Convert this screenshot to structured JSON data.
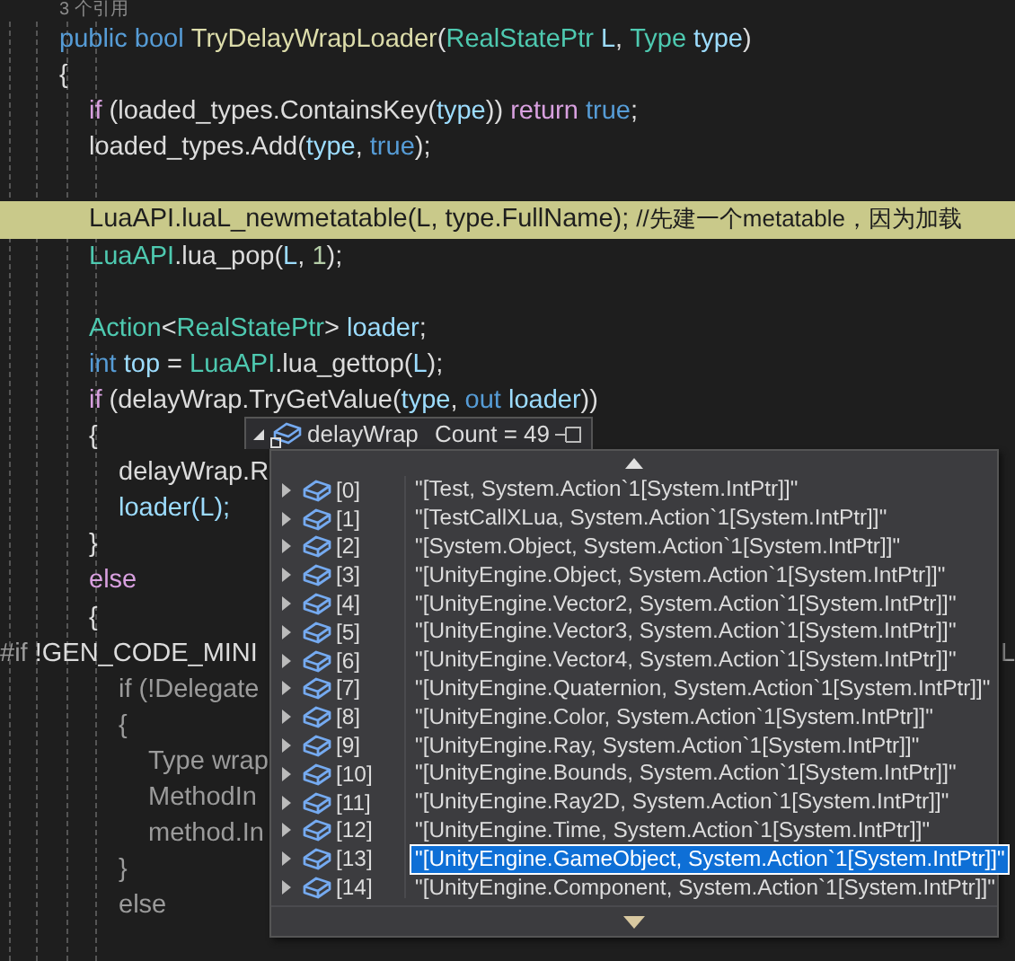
{
  "editor": {
    "codelens": "3 个引用",
    "lines": [
      {
        "tokens": [
          {
            "text": "public ",
            "kind": "kw"
          },
          {
            "text": "bool ",
            "kind": "kw"
          },
          {
            "text": "TryDelayWrapLoader",
            "kind": "method"
          },
          {
            "text": "(",
            "kind": "plain"
          },
          {
            "text": "RealStatePtr",
            "kind": "type"
          },
          {
            "text": " L",
            "kind": "var"
          },
          {
            "text": ", ",
            "kind": "plain"
          },
          {
            "text": "Type",
            "kind": "type"
          },
          {
            "text": " type",
            "kind": "var"
          },
          {
            "text": ")",
            "kind": "plain"
          }
        ]
      },
      {
        "tokens": [
          {
            "text": "{",
            "kind": "plain"
          }
        ],
        "children": [
          {
            "tokens": [
              {
                "text": "if",
                "kind": "ctrl"
              },
              {
                "text": " (loaded_types.ContainsKey(",
                "kind": "plain"
              },
              {
                "text": "type",
                "kind": "var"
              },
              {
                "text": ")) ",
                "kind": "plain"
              },
              {
                "text": "return",
                "kind": "ctrl"
              },
              {
                "text": " true",
                "kind": "kw"
              },
              {
                "text": ";",
                "kind": "plain"
              }
            ]
          },
          {
            "tokens": [
              {
                "text": "loaded_types.Add(",
                "kind": "plain"
              },
              {
                "text": "type",
                "kind": "var"
              },
              {
                "text": ", ",
                "kind": "plain"
              },
              {
                "text": "true",
                "kind": "kw"
              },
              {
                "text": ");",
                "kind": "plain"
              }
            ]
          },
          {
            "gap_before": true,
            "highlighted": true,
            "tokens": [
              {
                "text": "LuaAPI.luaL_newmetatable(L, type.FullName); ",
                "kind": "plain"
              },
              {
                "text": "//先建一个metatable，因为加载",
                "kind": "comment"
              }
            ]
          },
          {
            "tokens": [
              {
                "text": "LuaAPI",
                "kind": "type"
              },
              {
                "text": ".lua_pop(",
                "kind": "plain"
              },
              {
                "text": "L",
                "kind": "var"
              },
              {
                "text": ", ",
                "kind": "plain"
              },
              {
                "text": "1",
                "kind": "num"
              },
              {
                "text": ");",
                "kind": "plain"
              }
            ]
          },
          {
            "gap_before": true,
            "tokens": [
              {
                "text": "Action",
                "kind": "type"
              },
              {
                "text": "<",
                "kind": "plain"
              },
              {
                "text": "RealStatePtr",
                "kind": "type"
              },
              {
                "text": "> ",
                "kind": "plain"
              },
              {
                "text": "loader",
                "kind": "var"
              },
              {
                "text": ";",
                "kind": "plain"
              }
            ]
          },
          {
            "tokens": [
              {
                "text": "int",
                "kind": "kw"
              },
              {
                "text": " top",
                "kind": "var"
              },
              {
                "text": " = ",
                "kind": "plain"
              },
              {
                "text": "LuaAPI",
                "kind": "type"
              },
              {
                "text": ".lua_gettop(",
                "kind": "plain"
              },
              {
                "text": "L",
                "kind": "var"
              },
              {
                "text": ");",
                "kind": "plain"
              }
            ]
          },
          {
            "tokens": [
              {
                "text": "if",
                "kind": "ctrl"
              },
              {
                "text": " (delayWrap.TryGetValue(",
                "kind": "plain"
              },
              {
                "text": "type",
                "kind": "var"
              },
              {
                "text": ", ",
                "kind": "plain"
              },
              {
                "text": "out",
                "kind": "kw"
              },
              {
                "text": " loader",
                "kind": "var"
              },
              {
                "text": "))",
                "kind": "plain"
              }
            ]
          },
          {
            "tokens": [
              {
                "text": "{",
                "kind": "plain"
              }
            ],
            "children": [
              {
                "tokens": [
                  {
                    "text": "delayWrap.R",
                    "kind": "plain"
                  }
                ]
              },
              {
                "tokens": [
                  {
                    "text": "loader(L);",
                    "kind": "var"
                  }
                ]
              }
            ]
          },
          {
            "tokens": [
              {
                "text": "}",
                "kind": "plain"
              }
            ]
          },
          {
            "tokens": [
              {
                "text": "else",
                "kind": "ctrl"
              }
            ]
          },
          {
            "tokens": [
              {
                "text": "{",
                "kind": "plain"
              }
            ],
            "children": [
              {
                "kind": "directive",
                "tokens": [
                  {
                    "text": "#if",
                    "kind": "pre"
                  },
                  {
                    "text": " !GEN_CODE_MINI",
                    "kind": "plain"
                  }
                ],
                "right": "L"
              },
              {
                "tokens": [
                  {
                    "text": "if (!Delegate",
                    "kind": "dim"
                  }
                ]
              },
              {
                "tokens": [
                  {
                    "text": "{",
                    "kind": "dim"
                  }
                ],
                "children": [
                  {
                    "tokens": [
                      {
                        "text": "Type wrap",
                        "kind": "dim"
                      }
                    ]
                  },
                  {
                    "tokens": [
                      {
                        "text": "MethodIn",
                        "kind": "dim"
                      }
                    ]
                  },
                  {
                    "tokens": [
                      {
                        "text": "method.In",
                        "kind": "dim"
                      }
                    ]
                  }
                ]
              },
              {
                "tokens": [
                  {
                    "text": "}",
                    "kind": "dim"
                  }
                ]
              },
              {
                "tokens": [
                  {
                    "text": "else",
                    "kind": "dim"
                  }
                ]
              }
            ]
          }
        ]
      }
    ]
  },
  "datatip": {
    "name": "delayWrap",
    "value": "Count = 49",
    "rows": [
      {
        "index": "[0]",
        "value": "\"[Test, System.Action`1[System.IntPtr]]\"",
        "selected": false
      },
      {
        "index": "[1]",
        "value": "\"[TestCallXLua, System.Action`1[System.IntPtr]]\"",
        "selected": false
      },
      {
        "index": "[2]",
        "value": "\"[System.Object, System.Action`1[System.IntPtr]]\"",
        "selected": false
      },
      {
        "index": "[3]",
        "value": "\"[UnityEngine.Object, System.Action`1[System.IntPtr]]\"",
        "selected": false
      },
      {
        "index": "[4]",
        "value": "\"[UnityEngine.Vector2, System.Action`1[System.IntPtr]]\"",
        "selected": false
      },
      {
        "index": "[5]",
        "value": "\"[UnityEngine.Vector3, System.Action`1[System.IntPtr]]\"",
        "selected": false
      },
      {
        "index": "[6]",
        "value": "\"[UnityEngine.Vector4, System.Action`1[System.IntPtr]]\"",
        "selected": false
      },
      {
        "index": "[7]",
        "value": "\"[UnityEngine.Quaternion, System.Action`1[System.IntPtr]]\"",
        "selected": false
      },
      {
        "index": "[8]",
        "value": "\"[UnityEngine.Color, System.Action`1[System.IntPtr]]\"",
        "selected": false
      },
      {
        "index": "[9]",
        "value": "\"[UnityEngine.Ray, System.Action`1[System.IntPtr]]\"",
        "selected": false
      },
      {
        "index": "[10]",
        "value": "\"[UnityEngine.Bounds, System.Action`1[System.IntPtr]]\"",
        "selected": false
      },
      {
        "index": "[11]",
        "value": "\"[UnityEngine.Ray2D, System.Action`1[System.IntPtr]]\"",
        "selected": false
      },
      {
        "index": "[12]",
        "value": "\"[UnityEngine.Time, System.Action`1[System.IntPtr]]\"",
        "selected": false
      },
      {
        "index": "[13]",
        "value": "\"[UnityEngine.GameObject, System.Action`1[System.IntPtr]]\"",
        "selected": true
      },
      {
        "index": "[14]",
        "value": "\"[UnityEngine.Component, System.Action`1[System.IntPtr]]\"",
        "selected": false
      }
    ]
  }
}
